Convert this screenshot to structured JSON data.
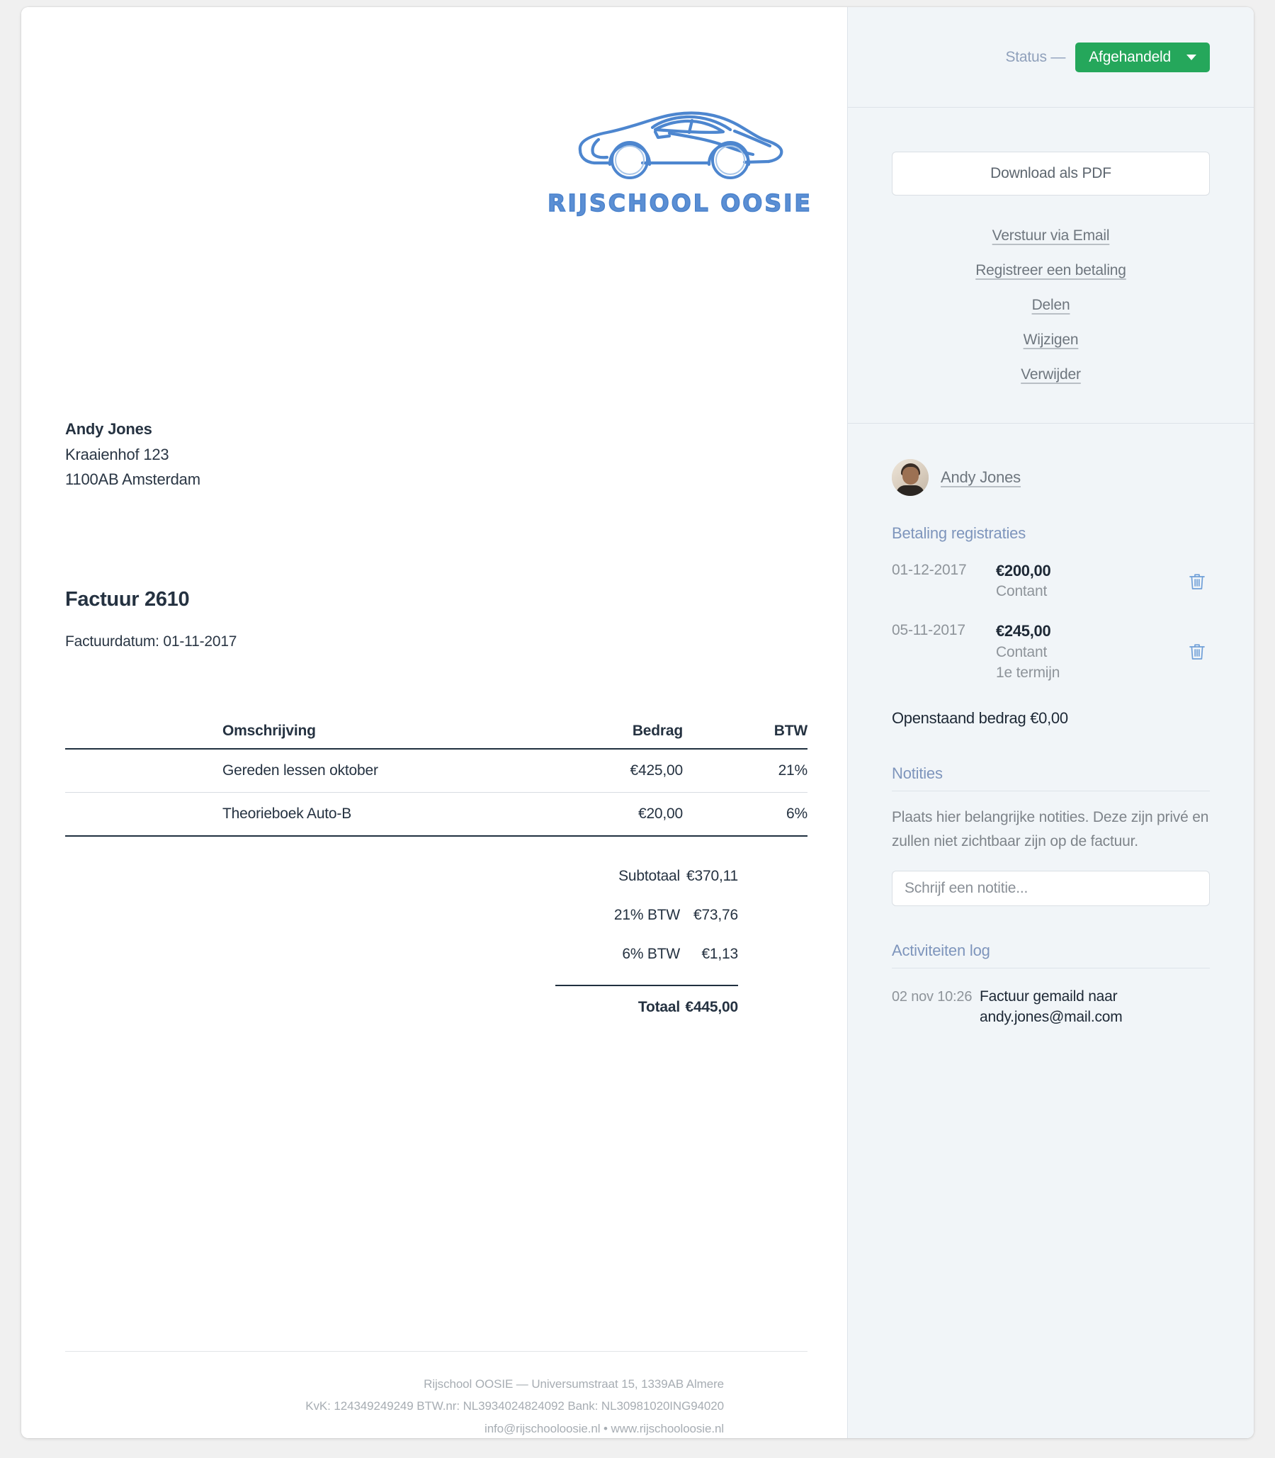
{
  "company": {
    "logo_word": "RIJSCHOOL OOSIE",
    "logo_icon": "sports-car-outline-icon"
  },
  "invoice": {
    "bill_to": {
      "name": "Andy Jones",
      "street": "Kraaienhof 123",
      "city": "1100AB Amsterdam"
    },
    "title": "Factuur 2610",
    "date_line": "Factuurdatum: 01-11-2017",
    "table": {
      "headers": {
        "description": "Omschrijving",
        "amount": "Bedrag",
        "vat": "BTW"
      },
      "rows": [
        {
          "description": "Gereden lessen oktober",
          "amount": "€425,00",
          "vat": "21%"
        },
        {
          "description": "Theorieboek Auto-B",
          "amount": "€20,00",
          "vat": "6%"
        }
      ]
    },
    "totals": [
      {
        "label": "Subtotaal",
        "value": "€370,11",
        "bold": false
      },
      {
        "label": "21% BTW",
        "value": "€73,76",
        "bold": false
      },
      {
        "label": "6% BTW",
        "value": "€1,13",
        "bold": false
      }
    ],
    "grand_total": {
      "label": "Totaal",
      "value": "€445,00"
    },
    "footer": {
      "line1": "Rijschool OOSIE — Universumstraat 15, 1339AB Almere",
      "line2": "KvK: 124349249249 BTW.nr: NL3934024824092 Bank: NL30981020ING94020",
      "line3": "info@rijschooloosie.nl • www.rijschooloosie.nl"
    }
  },
  "sidebar": {
    "status": {
      "label": "Status —",
      "value": "Afgehandeld",
      "color": "#25a75b"
    },
    "actions": {
      "pdf_button": "Download als PDF",
      "links": [
        "Verstuur via Email",
        "Registreer een betaling",
        "Delen",
        "Wijzigen",
        "Verwijder"
      ]
    },
    "customer": {
      "name": "Andy Jones",
      "avatar": "user-photo-avatar"
    },
    "payments": {
      "heading": "Betaling registraties",
      "rows": [
        {
          "date": "01-12-2017",
          "amount": "€200,00",
          "method": "Contant",
          "note": ""
        },
        {
          "date": "05-11-2017",
          "amount": "€245,00",
          "method": "Contant",
          "note": "1e termijn"
        }
      ],
      "outstanding": "Openstaand bedrag €0,00"
    },
    "notes": {
      "heading": "Notities",
      "description": "Plaats hier belangrijke notities. Deze zijn privé en zullen niet zichtbaar zijn op de factuur.",
      "input_placeholder": "Schrijf een notitie...",
      "input_value": ""
    },
    "activity": {
      "heading": "Activiteiten log",
      "entries": [
        {
          "time": "02 nov 10:26",
          "text": "Factuur gemaild naar andy.jones@mail.com"
        }
      ]
    }
  }
}
